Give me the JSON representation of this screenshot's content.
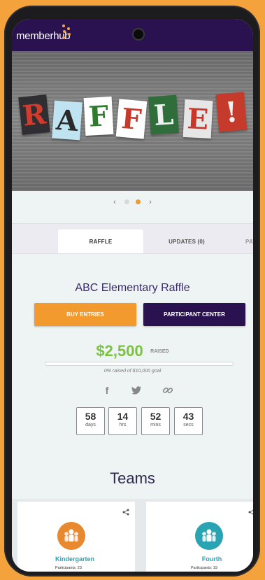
{
  "header": {
    "brand": "memberhub"
  },
  "hero": {
    "letters": [
      {
        "char": "R",
        "bg": "#2f2f33",
        "fg": "#d33b2c"
      },
      {
        "char": "A",
        "bg": "#bfe3f0",
        "fg": "#2a2a2a"
      },
      {
        "char": "F",
        "bg": "#ffffff",
        "fg": "#2e7d2e"
      },
      {
        "char": "F",
        "bg": "#ffffff",
        "fg": "#c53a2a"
      },
      {
        "char": "L",
        "bg": "#2f6e3a",
        "fg": "#f0f0f0"
      },
      {
        "char": "E",
        "bg": "#e6e6e6",
        "fg": "#c7382a"
      },
      {
        "char": "!",
        "bg": "#c53a2a",
        "fg": "#f0f0f0"
      }
    ]
  },
  "carousel": {
    "left_arrow": "‹",
    "right_arrow": "›",
    "active_index": 1
  },
  "tabs": [
    {
      "label": "RAFFLE",
      "active": true
    },
    {
      "label": "UPDATES (0)",
      "active": false
    },
    {
      "label": "PAYI",
      "active": false
    }
  ],
  "raffle": {
    "title": "ABC Elementary Raffle",
    "buy_label": "BUY ENTRIES",
    "participant_label": "PARTICIPANT CENTER",
    "amount": "$2,500",
    "raised_label": "RAISED",
    "progress_percent": 0,
    "goal_text": "0% raised of $10,000 goal"
  },
  "social": [
    {
      "name": "facebook-icon",
      "glyph": "f"
    },
    {
      "name": "twitter-icon",
      "glyph": "☁"
    },
    {
      "name": "link-icon",
      "glyph": "∞"
    }
  ],
  "countdown": [
    {
      "value": "58",
      "unit": "days"
    },
    {
      "value": "14",
      "unit": "hrs"
    },
    {
      "value": "52",
      "unit": "mins"
    },
    {
      "value": "43",
      "unit": "secs"
    }
  ],
  "teams": {
    "heading": "Teams",
    "items": [
      {
        "name": "Kindergarten",
        "participants": "Participants: 23",
        "color": "#e8892f"
      },
      {
        "name": "Fourth",
        "participants": "Participants: 19",
        "color": "#2aa3b3"
      }
    ]
  },
  "colors": {
    "brand_purple": "#2a1250",
    "accent_orange": "#f29a2e",
    "success_green": "#7bc143"
  }
}
